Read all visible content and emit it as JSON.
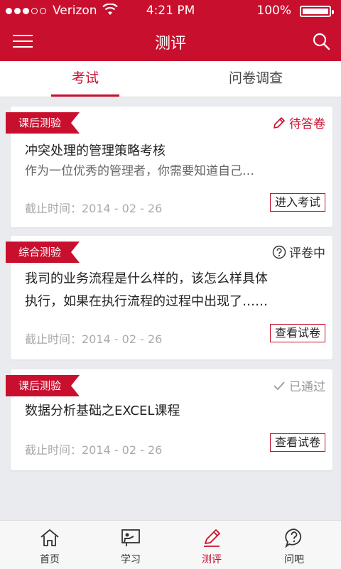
{
  "status_bar": {
    "carrier": "Verizon",
    "time": "4:21 PM",
    "battery": "100%"
  },
  "navbar": {
    "title": "测评"
  },
  "tabs": [
    {
      "label": "考试",
      "active": true
    },
    {
      "label": "问卷调查",
      "active": false
    }
  ],
  "cards": [
    {
      "tag": "课后测验",
      "status": "待答卷",
      "status_icon": "pencil-icon",
      "title": "冲突处理的管理策略考核",
      "description": "作为一位优秀的管理者，你需要知道自己…",
      "deadline": "截止时间：2014 - 02 - 26",
      "action": "进入考试"
    },
    {
      "tag": "综合测验",
      "status": "评卷中",
      "status_icon": "question-circle-icon",
      "title_line1": "我司的业务流程是什么样的，该怎么样具体",
      "title_line2": "执行，如果在执行流程的过程中出现了……",
      "deadline": "截止时间：2014 - 02 - 26",
      "action": "查看试卷"
    },
    {
      "tag": "课后测验",
      "status": "已通过",
      "status_icon": "check-icon",
      "title": "数据分析基础之EXCEL课程",
      "deadline": "截止时间：2014 - 02 - 26",
      "action": "查看试卷"
    }
  ],
  "bottom_nav": [
    {
      "label": "首页",
      "icon": "home-icon",
      "active": false
    },
    {
      "label": "学习",
      "icon": "study-icon",
      "active": false
    },
    {
      "label": "测评",
      "icon": "pencil-icon",
      "active": true
    },
    {
      "label": "问吧",
      "icon": "question-bubble-icon",
      "active": false
    }
  ],
  "colors": {
    "primary": "#c8102e",
    "background": "#e9ebee"
  }
}
